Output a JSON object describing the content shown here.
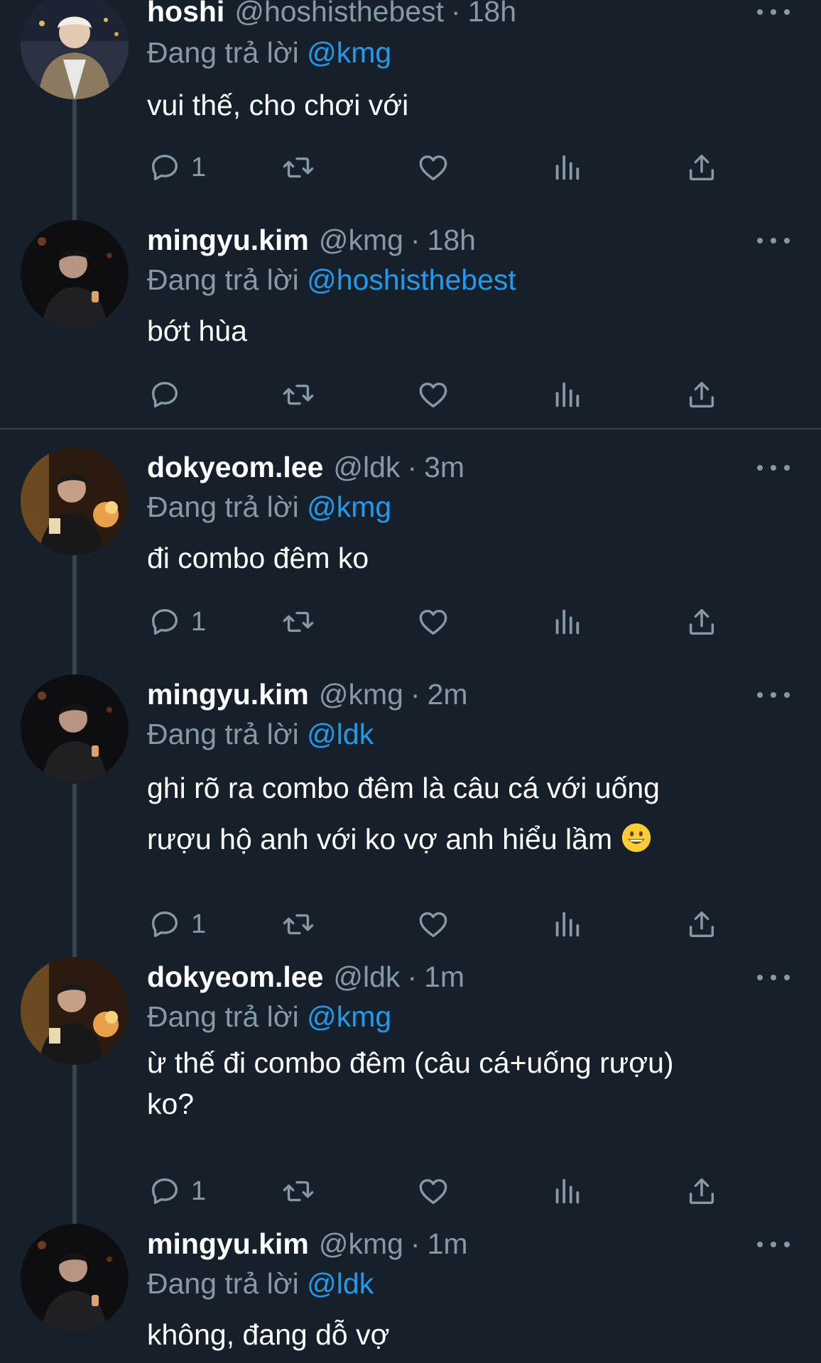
{
  "replying_prefix": "Đang trả lời",
  "tweets": [
    {
      "name": "hoshi",
      "handle": "@hoshisthebest",
      "sep": "·",
      "time": "18h",
      "reply_to": "@kmg",
      "text": "vui thế, cho chơi với",
      "reply_count": "1"
    },
    {
      "name": "mingyu.kim",
      "handle": "@kmg",
      "sep": "·",
      "time": "18h",
      "reply_to": "@hoshisthebest",
      "text": "bớt hùa",
      "reply_count": ""
    },
    {
      "name": "dokyeom.lee",
      "handle": "@ldk",
      "sep": "·",
      "time": "3m",
      "reply_to": "@kmg",
      "text": "đi combo đêm ko",
      "reply_count": "1"
    },
    {
      "name": "mingyu.kim",
      "handle": "@kmg",
      "sep": "·",
      "time": "2m",
      "reply_to": "@ldk",
      "text_line1": "ghi rõ ra combo đêm là câu cá với uống",
      "text_line2": "rượu hộ anh với ko vợ anh hiểu lầm",
      "emoji": "grinning-face",
      "reply_count": "1"
    },
    {
      "name": "dokyeom.lee",
      "handle": "@ldk",
      "sep": "·",
      "time": "1m",
      "reply_to": "@kmg",
      "text_line1": "ừ thế đi combo đêm (câu cá+uống rượu)",
      "text_line2": "ko?",
      "reply_count": "1"
    },
    {
      "name": "mingyu.kim",
      "handle": "@kmg",
      "sep": "·",
      "time": "1m",
      "reply_to": "@ldk",
      "text": "không, đang dỗ vợ"
    }
  ],
  "icons": {
    "reply": "reply-icon",
    "retweet": "retweet-icon",
    "like": "heart-icon",
    "views": "views-icon",
    "share": "share-icon",
    "more": "more-icon"
  },
  "colors": {
    "background": "#15202b",
    "secondary_text": "#8899a6",
    "mention": "#1d9bf0",
    "thread_line": "#38444d"
  }
}
